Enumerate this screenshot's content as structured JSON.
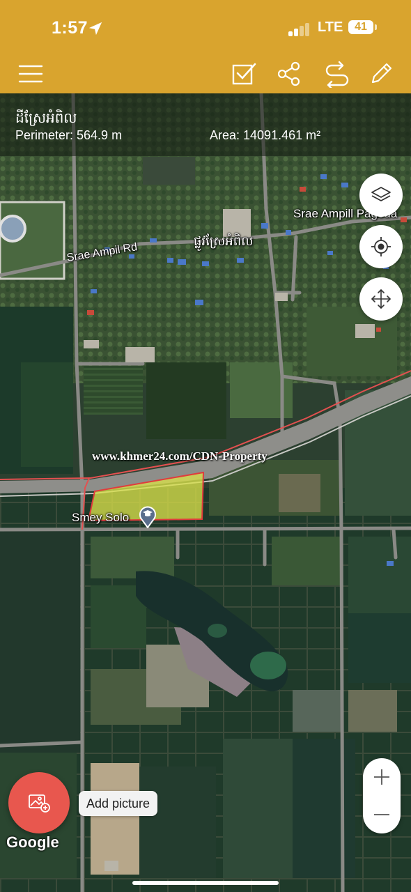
{
  "status_bar": {
    "time": "1:57",
    "network": "LTE",
    "battery": "41"
  },
  "toolbar": {
    "icons": [
      "menu-icon",
      "checkbox-icon",
      "share-icon",
      "undo-icon",
      "edit-icon"
    ]
  },
  "parcel": {
    "name": "ដីស្រែអំពិល",
    "perimeter": "Perimeter: 564.9 m",
    "area": "Area: 14091.461 m²"
  },
  "map": {
    "labels": {
      "pagoda": "Srae Ampill Pagoda",
      "road_en": "Srae Ampil Rd",
      "road_km": "ផ្លូវស្រែអំពិល",
      "poi": "Smey Solo"
    },
    "watermark": "www.khmer24.com/CDN-Property",
    "attribution": "Google",
    "colors": {
      "toolbar": "#d9a42e",
      "parcel_fill": "#d8e04a",
      "parcel_outline": "#e03c3c",
      "fab": "#e8574e"
    }
  },
  "controls": {
    "add_picture_label": "Add picture"
  }
}
